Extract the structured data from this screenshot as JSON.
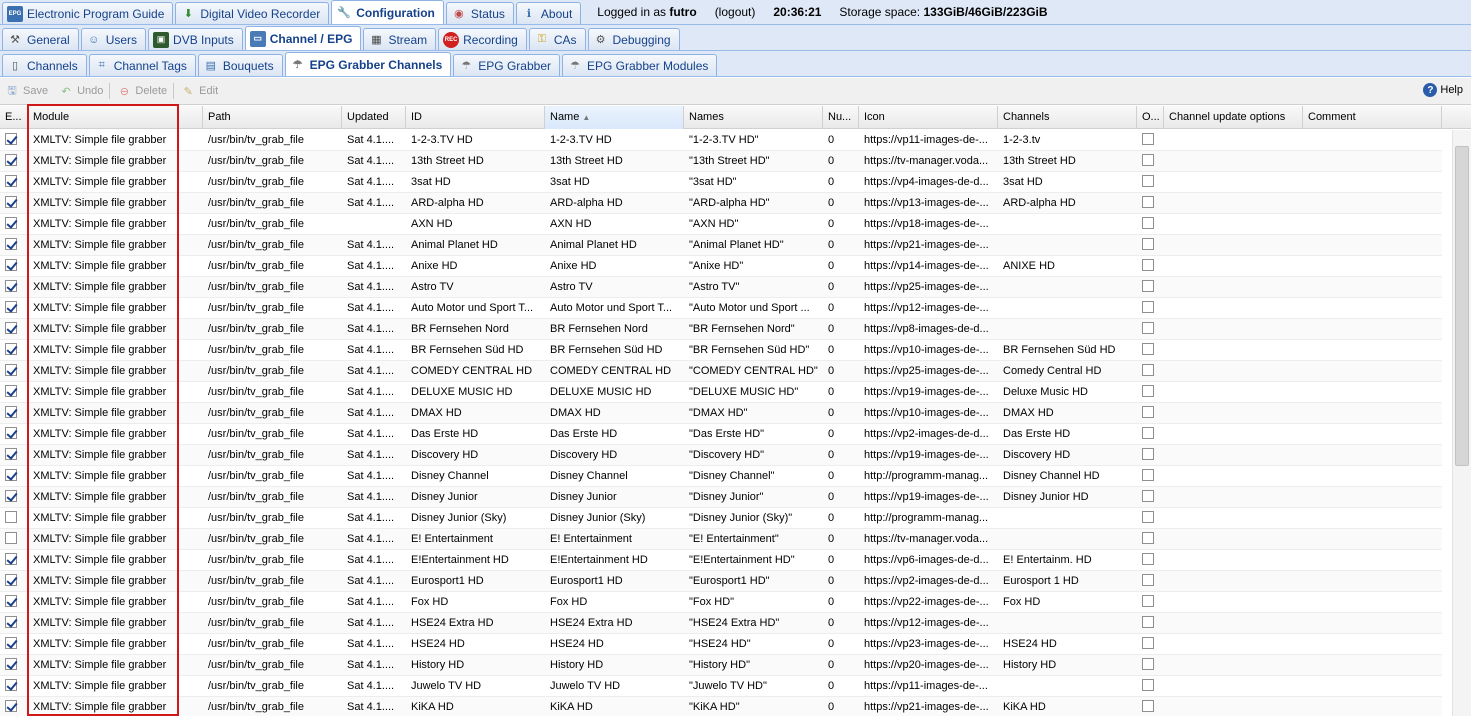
{
  "top_tabs": [
    {
      "label": "Electronic Program Guide",
      "icon": "epg-icon",
      "active": false
    },
    {
      "label": "Digital Video Recorder",
      "icon": "download-icon",
      "active": false
    },
    {
      "label": "Configuration",
      "icon": "wrench-icon",
      "active": true
    },
    {
      "label": "Status",
      "icon": "eye-icon",
      "active": false
    },
    {
      "label": "About",
      "icon": "info-icon",
      "active": false
    }
  ],
  "session": {
    "logged_in_prefix": "Logged in as",
    "user": "futro",
    "logout": "(logout)",
    "time": "20:36:21",
    "storage_label": "Storage space:",
    "storage_value": "133GiB/46GiB/223GiB"
  },
  "config_tabs": [
    {
      "label": "General",
      "icon": "tools-icon",
      "active": false
    },
    {
      "label": "Users",
      "icon": "users-icon",
      "active": false
    },
    {
      "label": "DVB Inputs",
      "icon": "chip-icon",
      "active": false
    },
    {
      "label": "Channel / EPG",
      "icon": "tv-icon",
      "active": true
    },
    {
      "label": "Stream",
      "icon": "film-icon",
      "active": false
    },
    {
      "label": "Recording",
      "icon": "rec-icon",
      "active": false
    },
    {
      "label": "CAs",
      "icon": "key-icon",
      "active": false
    },
    {
      "label": "Debugging",
      "icon": "bug-icon",
      "active": false
    }
  ],
  "sub_tabs": [
    {
      "label": "Channels",
      "icon": "phone-icon",
      "active": false
    },
    {
      "label": "Channel Tags",
      "icon": "tag-icon",
      "active": false
    },
    {
      "label": "Bouquets",
      "icon": "bouquet-icon",
      "active": false
    },
    {
      "label": "EPG Grabber Channels",
      "icon": "grabber-icon",
      "active": true
    },
    {
      "label": "EPG Grabber",
      "icon": "grabber-icon",
      "active": false
    },
    {
      "label": "EPG Grabber Modules",
      "icon": "grabber-icon",
      "active": false
    }
  ],
  "toolbar": {
    "save": "Save",
    "undo": "Undo",
    "delete": "Delete",
    "edit": "Edit",
    "help": "Help"
  },
  "columns": [
    "E...",
    "Module",
    "Path",
    "Updated",
    "ID",
    "Name",
    "Names",
    "Nu...",
    "Icon",
    "Channels",
    "O...",
    "Channel update options",
    "Comment"
  ],
  "rows": [
    {
      "enabled": true,
      "module": "XMLTV: Simple file grabber",
      "path": "/usr/bin/tv_grab_file",
      "updated": "Sat 4.1....",
      "id": "1-2-3.TV HD",
      "name": "1-2-3.TV HD",
      "names": "\"1-2-3.TV HD\"",
      "num": "0",
      "icon": "https://vp11-images-de-...",
      "channels": "1-2-3.tv",
      "o": false
    },
    {
      "enabled": true,
      "module": "XMLTV: Simple file grabber",
      "path": "/usr/bin/tv_grab_file",
      "updated": "Sat 4.1....",
      "id": "13th Street HD",
      "name": "13th Street HD",
      "names": "\"13th Street HD\"",
      "num": "0",
      "icon": "https://tv-manager.voda...",
      "channels": "13th Street HD",
      "o": false
    },
    {
      "enabled": true,
      "module": "XMLTV: Simple file grabber",
      "path": "/usr/bin/tv_grab_file",
      "updated": "Sat 4.1....",
      "id": "3sat HD",
      "name": "3sat HD",
      "names": "\"3sat HD\"",
      "num": "0",
      "icon": "https://vp4-images-de-d...",
      "channels": "3sat HD",
      "o": false
    },
    {
      "enabled": true,
      "module": "XMLTV: Simple file grabber",
      "path": "/usr/bin/tv_grab_file",
      "updated": "Sat 4.1....",
      "id": "ARD-alpha HD",
      "name": "ARD-alpha HD",
      "names": "\"ARD-alpha HD\"",
      "num": "0",
      "icon": "https://vp13-images-de-...",
      "channels": "ARD-alpha HD",
      "o": false
    },
    {
      "enabled": true,
      "module": "XMLTV: Simple file grabber",
      "path": "/usr/bin/tv_grab_file",
      "updated": "",
      "id": "AXN HD",
      "name": "AXN HD",
      "names": "\"AXN HD\"",
      "num": "0",
      "icon": "https://vp18-images-de-...",
      "channels": "",
      "o": false
    },
    {
      "enabled": true,
      "module": "XMLTV: Simple file grabber",
      "path": "/usr/bin/tv_grab_file",
      "updated": "Sat 4.1....",
      "id": "Animal Planet HD",
      "name": "Animal Planet HD",
      "names": "\"Animal Planet HD\"",
      "num": "0",
      "icon": "https://vp21-images-de-...",
      "channels": "",
      "o": false
    },
    {
      "enabled": true,
      "module": "XMLTV: Simple file grabber",
      "path": "/usr/bin/tv_grab_file",
      "updated": "Sat 4.1....",
      "id": "Anixe HD",
      "name": "Anixe HD",
      "names": "\"Anixe HD\"",
      "num": "0",
      "icon": "https://vp14-images-de-...",
      "channels": "ANIXE HD",
      "o": false
    },
    {
      "enabled": true,
      "module": "XMLTV: Simple file grabber",
      "path": "/usr/bin/tv_grab_file",
      "updated": "Sat 4.1....",
      "id": "Astro TV",
      "name": "Astro TV",
      "names": "\"Astro TV\"",
      "num": "0",
      "icon": "https://vp25-images-de-...",
      "channels": "",
      "o": false
    },
    {
      "enabled": true,
      "module": "XMLTV: Simple file grabber",
      "path": "/usr/bin/tv_grab_file",
      "updated": "Sat 4.1....",
      "id": "Auto Motor und Sport T...",
      "name": "Auto Motor und Sport T...",
      "names": "\"Auto Motor und Sport ...",
      "num": "0",
      "icon": "https://vp12-images-de-...",
      "channels": "",
      "o": false
    },
    {
      "enabled": true,
      "module": "XMLTV: Simple file grabber",
      "path": "/usr/bin/tv_grab_file",
      "updated": "Sat 4.1....",
      "id": "BR Fernsehen Nord",
      "name": "BR Fernsehen Nord",
      "names": "\"BR Fernsehen Nord\"",
      "num": "0",
      "icon": "https://vp8-images-de-d...",
      "channels": "",
      "o": false
    },
    {
      "enabled": true,
      "module": "XMLTV: Simple file grabber",
      "path": "/usr/bin/tv_grab_file",
      "updated": "Sat 4.1....",
      "id": "BR Fernsehen Süd HD",
      "name": "BR Fernsehen Süd HD",
      "names": "\"BR Fernsehen Süd HD\"",
      "num": "0",
      "icon": "https://vp10-images-de-...",
      "channels": "BR Fernsehen Süd HD",
      "o": false
    },
    {
      "enabled": true,
      "module": "XMLTV: Simple file grabber",
      "path": "/usr/bin/tv_grab_file",
      "updated": "Sat 4.1....",
      "id": "COMEDY CENTRAL HD",
      "name": "COMEDY CENTRAL HD",
      "names": "\"COMEDY CENTRAL HD\"",
      "num": "0",
      "icon": "https://vp25-images-de-...",
      "channels": "Comedy Central HD",
      "o": false
    },
    {
      "enabled": true,
      "module": "XMLTV: Simple file grabber",
      "path": "/usr/bin/tv_grab_file",
      "updated": "Sat 4.1....",
      "id": "DELUXE MUSIC HD",
      "name": "DELUXE MUSIC HD",
      "names": "\"DELUXE MUSIC HD\"",
      "num": "0",
      "icon": "https://vp19-images-de-...",
      "channels": "Deluxe Music HD",
      "o": false
    },
    {
      "enabled": true,
      "module": "XMLTV: Simple file grabber",
      "path": "/usr/bin/tv_grab_file",
      "updated": "Sat 4.1....",
      "id": "DMAX HD",
      "name": "DMAX HD",
      "names": "\"DMAX HD\"",
      "num": "0",
      "icon": "https://vp10-images-de-...",
      "channels": "DMAX HD",
      "o": false
    },
    {
      "enabled": true,
      "module": "XMLTV: Simple file grabber",
      "path": "/usr/bin/tv_grab_file",
      "updated": "Sat 4.1....",
      "id": "Das Erste HD",
      "name": "Das Erste HD",
      "names": "\"Das Erste HD\"",
      "num": "0",
      "icon": "https://vp2-images-de-d...",
      "channels": "Das Erste HD",
      "o": false
    },
    {
      "enabled": true,
      "module": "XMLTV: Simple file grabber",
      "path": "/usr/bin/tv_grab_file",
      "updated": "Sat 4.1....",
      "id": "Discovery HD",
      "name": "Discovery HD",
      "names": "\"Discovery HD\"",
      "num": "0",
      "icon": "https://vp19-images-de-...",
      "channels": "Discovery HD",
      "o": false
    },
    {
      "enabled": true,
      "module": "XMLTV: Simple file grabber",
      "path": "/usr/bin/tv_grab_file",
      "updated": "Sat 4.1....",
      "id": "Disney Channel",
      "name": "Disney Channel",
      "names": "\"Disney Channel\"",
      "num": "0",
      "icon": "http://programm-manag...",
      "channels": "Disney Channel HD",
      "o": false
    },
    {
      "enabled": true,
      "module": "XMLTV: Simple file grabber",
      "path": "/usr/bin/tv_grab_file",
      "updated": "Sat 4.1....",
      "id": "Disney Junior",
      "name": "Disney Junior",
      "names": "\"Disney Junior\"",
      "num": "0",
      "icon": "https://vp19-images-de-...",
      "channels": "Disney Junior HD",
      "o": false
    },
    {
      "enabled": false,
      "module": "XMLTV: Simple file grabber",
      "path": "/usr/bin/tv_grab_file",
      "updated": "Sat 4.1....",
      "id": "Disney Junior (Sky)",
      "name": "Disney Junior (Sky)",
      "names": "\"Disney Junior (Sky)\"",
      "num": "0",
      "icon": "http://programm-manag...",
      "channels": "",
      "o": false
    },
    {
      "enabled": false,
      "module": "XMLTV: Simple file grabber",
      "path": "/usr/bin/tv_grab_file",
      "updated": "Sat 4.1....",
      "id": "E! Entertainment",
      "name": "E! Entertainment",
      "names": "\"E! Entertainment\"",
      "num": "0",
      "icon": "https://tv-manager.voda...",
      "channels": "",
      "o": false
    },
    {
      "enabled": true,
      "module": "XMLTV: Simple file grabber",
      "path": "/usr/bin/tv_grab_file",
      "updated": "Sat 4.1....",
      "id": "E!Entertainment HD",
      "name": "E!Entertainment HD",
      "names": "\"E!Entertainment HD\"",
      "num": "0",
      "icon": "https://vp6-images-de-d...",
      "channels": "E! Entertainm. HD",
      "o": false
    },
    {
      "enabled": true,
      "module": "XMLTV: Simple file grabber",
      "path": "/usr/bin/tv_grab_file",
      "updated": "Sat 4.1....",
      "id": "Eurosport1 HD",
      "name": "Eurosport1 HD",
      "names": "\"Eurosport1 HD\"",
      "num": "0",
      "icon": "https://vp2-images-de-d...",
      "channels": "Eurosport 1 HD",
      "o": false
    },
    {
      "enabled": true,
      "module": "XMLTV: Simple file grabber",
      "path": "/usr/bin/tv_grab_file",
      "updated": "Sat 4.1....",
      "id": "Fox HD",
      "name": "Fox HD",
      "names": "\"Fox HD\"",
      "num": "0",
      "icon": "https://vp22-images-de-...",
      "channels": "Fox HD",
      "o": false
    },
    {
      "enabled": true,
      "module": "XMLTV: Simple file grabber",
      "path": "/usr/bin/tv_grab_file",
      "updated": "Sat 4.1....",
      "id": "HSE24 Extra HD",
      "name": "HSE24 Extra HD",
      "names": "\"HSE24 Extra HD\"",
      "num": "0",
      "icon": "https://vp12-images-de-...",
      "channels": "",
      "o": false
    },
    {
      "enabled": true,
      "module": "XMLTV: Simple file grabber",
      "path": "/usr/bin/tv_grab_file",
      "updated": "Sat 4.1....",
      "id": "HSE24 HD",
      "name": "HSE24 HD",
      "names": "\"HSE24 HD\"",
      "num": "0",
      "icon": "https://vp23-images-de-...",
      "channels": "HSE24 HD",
      "o": false
    },
    {
      "enabled": true,
      "module": "XMLTV: Simple file grabber",
      "path": "/usr/bin/tv_grab_file",
      "updated": "Sat 4.1....",
      "id": "History HD",
      "name": "History HD",
      "names": "\"History HD\"",
      "num": "0",
      "icon": "https://vp20-images-de-...",
      "channels": "History HD",
      "o": false
    },
    {
      "enabled": true,
      "module": "XMLTV: Simple file grabber",
      "path": "/usr/bin/tv_grab_file",
      "updated": "Sat 4.1....",
      "id": "Juwelo TV HD",
      "name": "Juwelo TV HD",
      "names": "\"Juwelo TV HD\"",
      "num": "0",
      "icon": "https://vp11-images-de-...",
      "channels": "",
      "o": false
    },
    {
      "enabled": true,
      "module": "XMLTV: Simple file grabber",
      "path": "/usr/bin/tv_grab_file",
      "updated": "Sat 4.1....",
      "id": "KiKA HD",
      "name": "KiKA HD",
      "names": "\"KiKA HD\"",
      "num": "0",
      "icon": "https://vp21-images-de-...",
      "channels": "KiKA HD",
      "o": false
    }
  ]
}
